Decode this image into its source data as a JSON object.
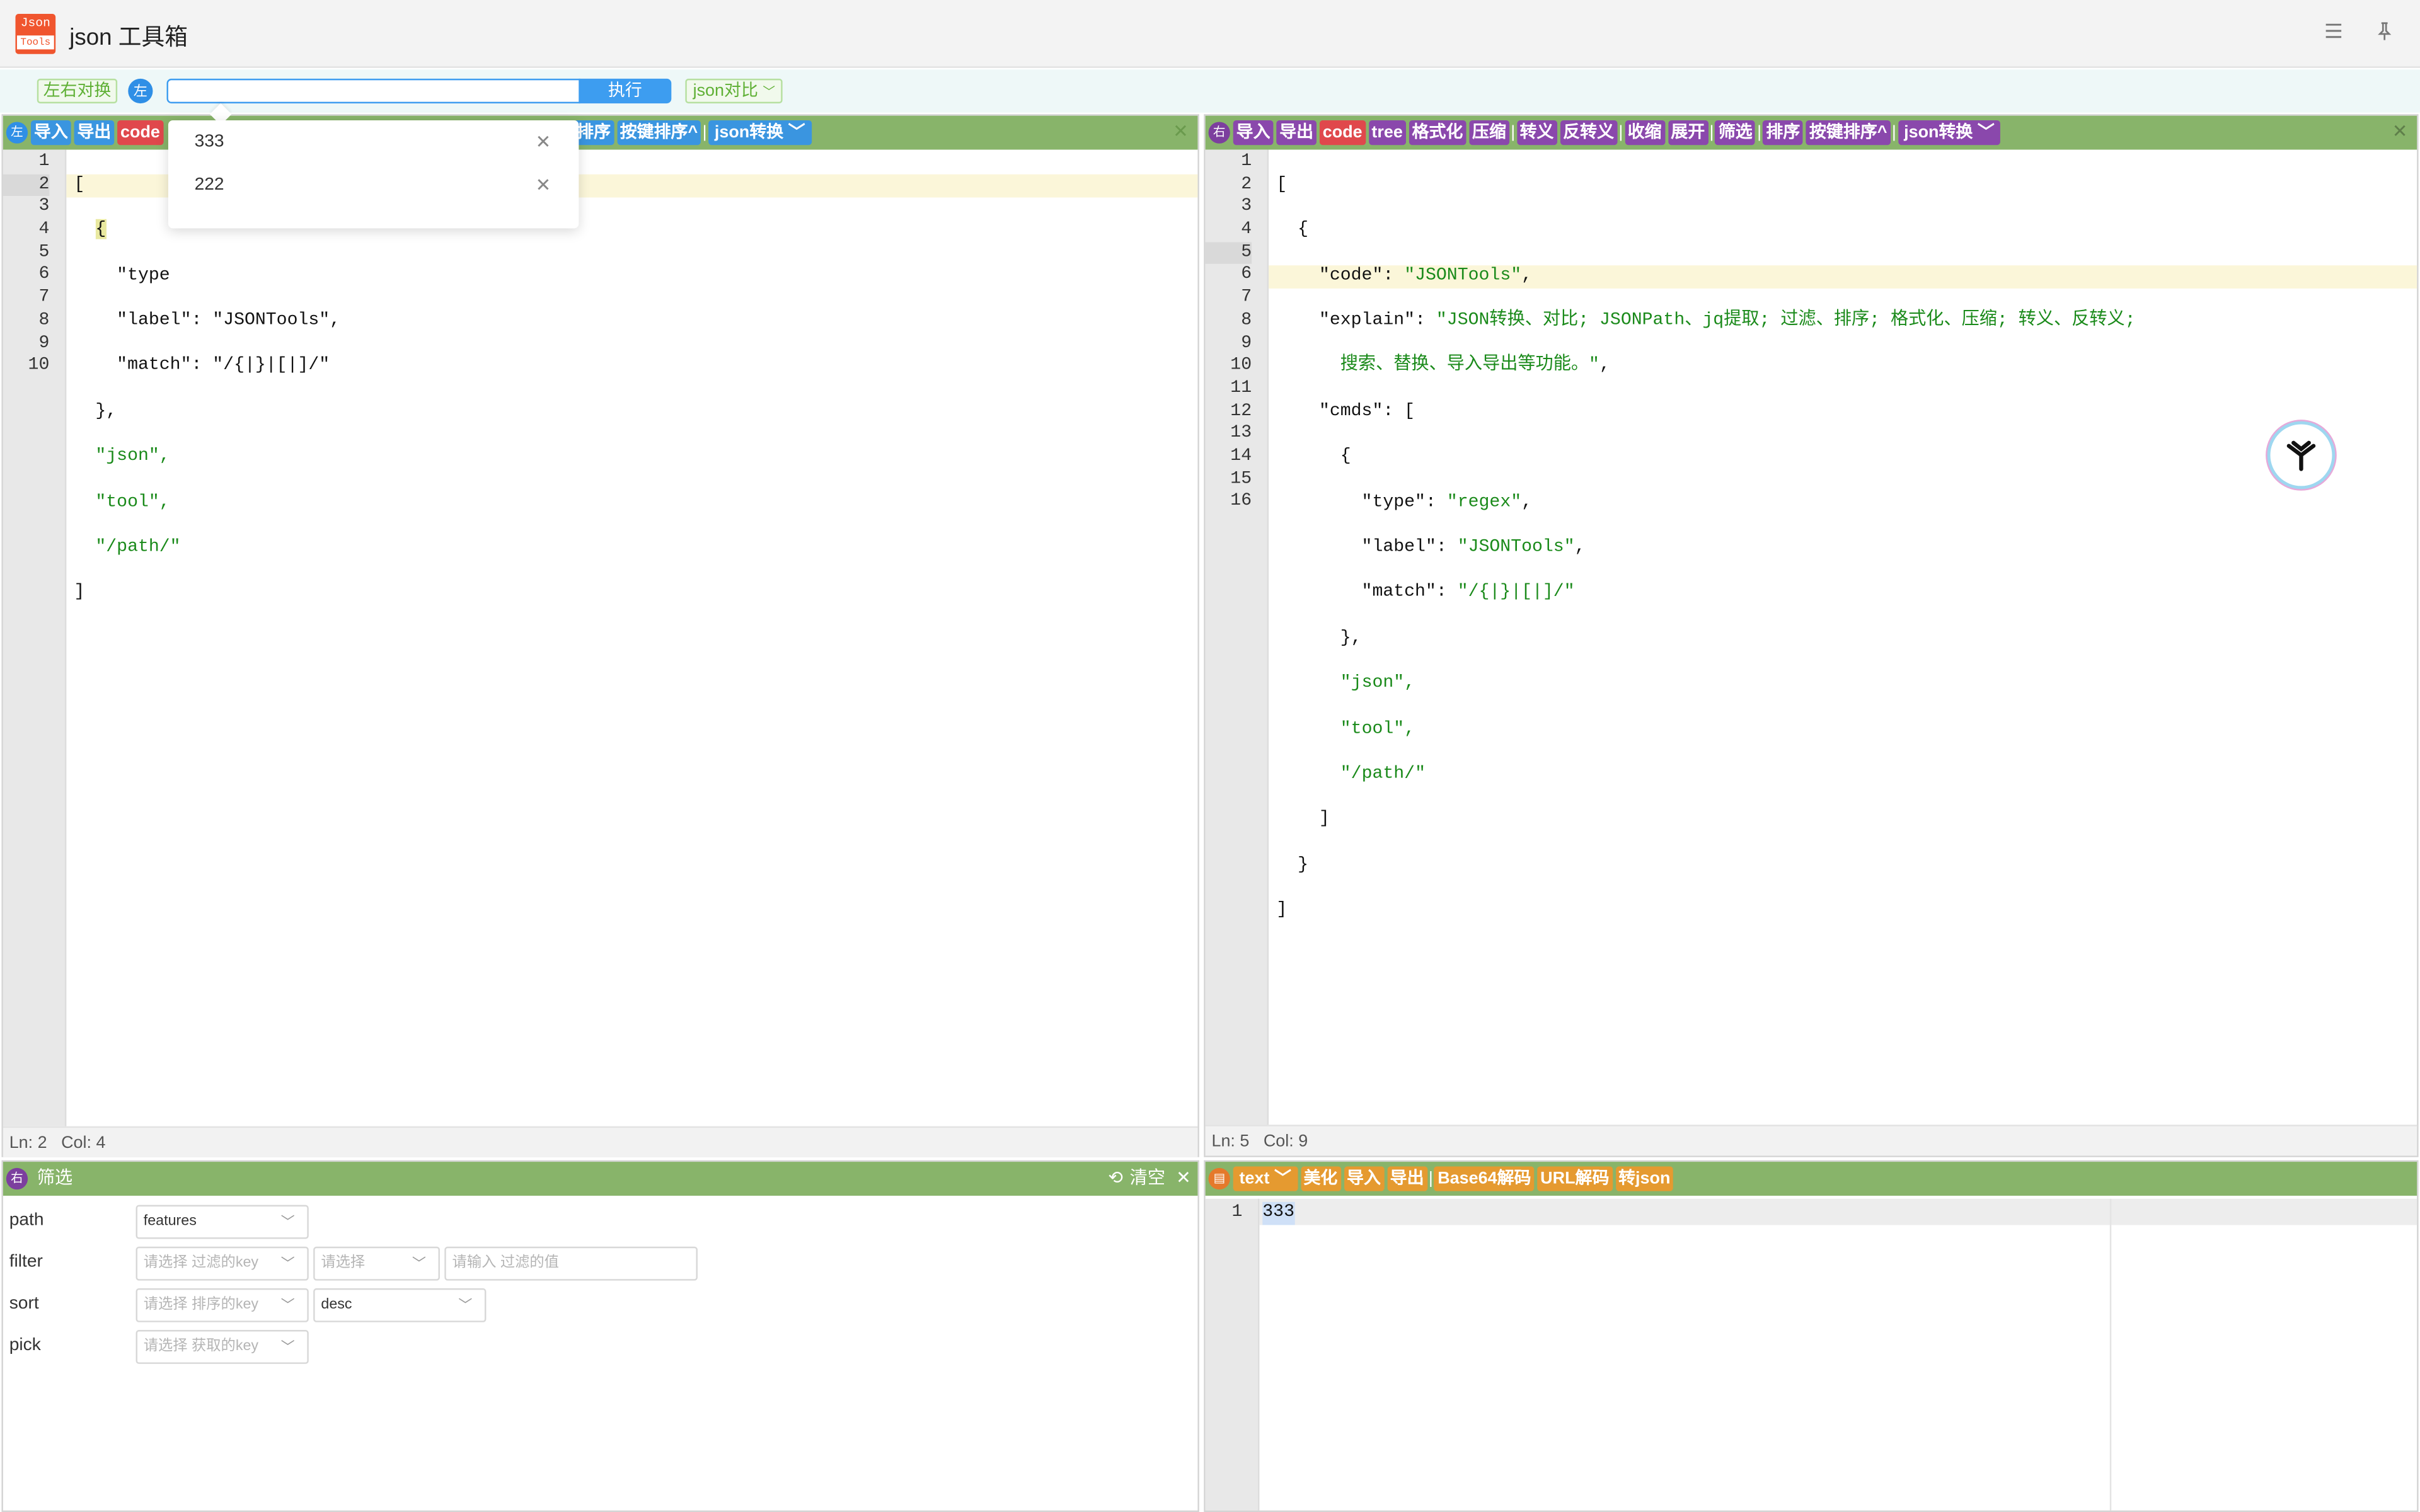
{
  "app": {
    "title": "json 工具箱",
    "logo_line1": "Json",
    "logo_line2": "Tools"
  },
  "titlebar": {
    "menu_icon": "menu-icon",
    "pin_icon": "pin-icon"
  },
  "controls": {
    "swap_label": "左右对换",
    "side_label": "左",
    "exec_label": "执行",
    "exec_value": "",
    "compare_select": "json对比"
  },
  "history_dropdown": {
    "items": [
      {
        "label": "333"
      },
      {
        "label": "222"
      }
    ]
  },
  "left_toolbar": {
    "side": "左",
    "import": "导入",
    "export": "导出",
    "code": "code",
    "sort": "排序",
    "sort_by_key": "按键排序",
    "convert": "json转换"
  },
  "right_toolbar": {
    "side": "右",
    "import": "导入",
    "export": "导出",
    "code": "code",
    "tree": "tree",
    "format": "格式化",
    "compress": "压缩",
    "escape": "转义",
    "unescape": "反转义",
    "collapse": "收缩",
    "expand": "展开",
    "filter": "筛选",
    "sort": "排序",
    "sort_by_key": "按键排序",
    "convert": "json转换"
  },
  "left_editor": {
    "line_numbers": [
      "1",
      "2",
      "3",
      "4",
      "5",
      "6",
      "7",
      "8",
      "9",
      "10"
    ],
    "visible_code": {
      "type_key": "\"type",
      "label_key": "\"label\": \"JSONTools\",",
      "match_line": "\"match\": \"/{|}|[|]/\"",
      "close": "},",
      "json": "\"json\",",
      "tool": "\"tool\",",
      "path": "\"/path/\""
    },
    "status": {
      "ln": "Ln: 2",
      "col": "Col: 4"
    }
  },
  "right_editor": {
    "line_numbers": [
      "1",
      "2",
      "3",
      "4",
      "5",
      "6",
      "7",
      "8",
      "9",
      "10",
      "11",
      "12",
      "13",
      "14",
      "15",
      "16"
    ],
    "code": {
      "code_key": "\"code\"",
      "code_val": "\"JSONTools\"",
      "explain_key": "\"explain\"",
      "explain_val_1": "\"JSON转换、对比; JSONPath、jq提取; 过滤、排序; 格式化、压缩; 转义、反转义;",
      "explain_val_2": "搜索、替换、导入导出等功能。\"",
      "cmds_key": "\"cmds\"",
      "type_key": "\"type\"",
      "type_val": "\"regex\"",
      "label_key": "\"label\"",
      "label_val": "\"JSONTools\"",
      "match_key": "\"match\"",
      "match_val": "\"/{|}|[|]/\"",
      "json": "\"json\"",
      "tool": "\"tool\"",
      "path": "\"/path/\""
    },
    "status": {
      "ln": "Ln: 5",
      "col": "Col: 9"
    }
  },
  "filter_panel": {
    "side": "右",
    "title": "筛选",
    "clear": "清空",
    "rows": {
      "path": {
        "label": "path",
        "value": "features"
      },
      "filter": {
        "label": "filter",
        "key_ph": "请选择 过滤的key",
        "op_ph": "请选择",
        "val_ph": "请输入 过滤的值"
      },
      "sort": {
        "label": "sort",
        "key_ph": "请选择 排序的key",
        "order": "desc"
      },
      "pick": {
        "label": "pick",
        "key_ph": "请选择 获取的key"
      }
    }
  },
  "text_panel": {
    "mode": "text",
    "beautify": "美化",
    "import": "导入",
    "export": "导出",
    "base64": "Base64解码",
    "url": "URL解码",
    "tojson": "转json",
    "line": "1",
    "content": "333"
  }
}
